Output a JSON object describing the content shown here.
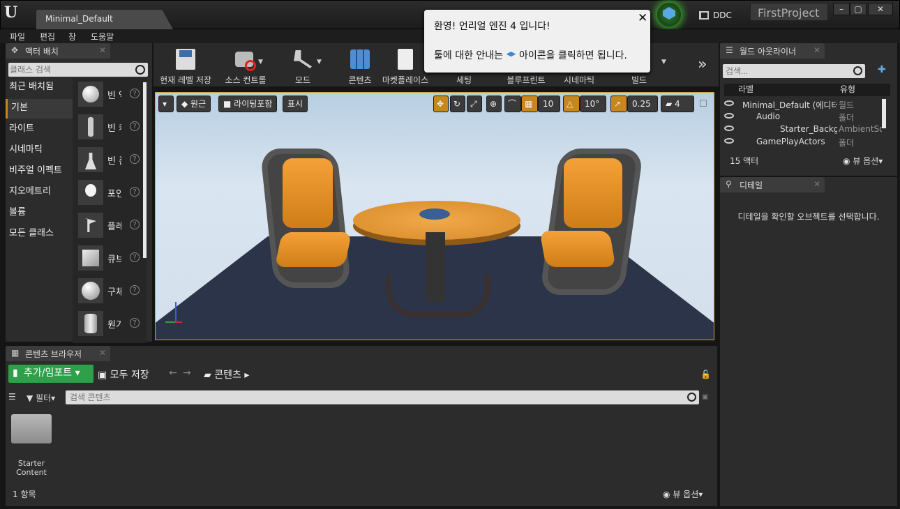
{
  "window": {
    "level_tab": "Minimal_Default",
    "project_name": "FirstProject",
    "ddc_label": "DDC"
  },
  "menu": [
    "파일",
    "편집",
    "창",
    "도움말"
  ],
  "toast": {
    "line1": "환영! 언리얼 엔진 4 입니다!",
    "line2_before": "툴에 대한 안내는 ",
    "line2_after": " 아이콘을 클릭하면 됩니다."
  },
  "place_mode": {
    "tab_label": "액터 배치",
    "search_placeholder": "클래스 검색",
    "categories": [
      "최근 배치됨",
      "기본",
      "라이트",
      "시네마틱",
      "비주얼 이펙트",
      "지오메트리",
      "볼륨",
      "모든 클래스"
    ],
    "selected_category": "기본",
    "items": [
      {
        "label": "빈 액터",
        "icon": "empty-actor-icon"
      },
      {
        "label": "빈 캐릭터",
        "icon": "empty-character-icon"
      },
      {
        "label": "빈 폰",
        "icon": "empty-pawn-icon"
      },
      {
        "label": "포인트 라이트",
        "icon": "point-light-icon"
      },
      {
        "label": "플레이어 스타트",
        "icon": "player-start-icon"
      },
      {
        "label": "큐브",
        "icon": "cube-icon"
      },
      {
        "label": "구체",
        "icon": "sphere-icon"
      },
      {
        "label": "원기둥",
        "icon": "cylinder-icon"
      }
    ]
  },
  "toolbar": [
    {
      "label": "현재 레벨 저장",
      "icon": "save-icon"
    },
    {
      "label": "소스 컨트롤",
      "icon": "source-control-icon"
    },
    {
      "label": "모드",
      "icon": "modes-icon"
    },
    {
      "label": "콘텐츠",
      "icon": "content-icon"
    },
    {
      "label": "마켓플레이스",
      "icon": "marketplace-icon"
    },
    {
      "label": "세팅",
      "icon": "settings-icon"
    },
    {
      "label": "블루프린트",
      "icon": "blueprint-icon"
    },
    {
      "label": "시네마틱",
      "icon": "cinematics-icon"
    },
    {
      "label": "빌드",
      "icon": "build-icon"
    }
  ],
  "viewport": {
    "perspective": "원근",
    "lighting": "라이팅포함",
    "show": "표시",
    "grid_snap": "10",
    "rotation_snap": "10°",
    "scale_snap": "0.25",
    "camera_speed": "4"
  },
  "outliner": {
    "tab_label": "월드 아웃라이너",
    "search_placeholder": "검색...",
    "col_label": "라벨",
    "col_type": "유형",
    "rows": [
      {
        "name": "Minimal_Default (에디터)",
        "type": "월드",
        "indent": 1
      },
      {
        "name": "Audio",
        "type": "폴더",
        "indent": 2
      },
      {
        "name": "Starter_Background",
        "type": "AmbientSound",
        "indent": 3
      },
      {
        "name": "GamePlayActors",
        "type": "폴더",
        "indent": 2
      }
    ],
    "actor_count": "15 액터",
    "view_options": "뷰 옵션"
  },
  "details": {
    "tab_label": "디테일",
    "empty_message": "디테일을 확인할 오브젝트를 선택합니다."
  },
  "content_browser": {
    "tab_label": "콘텐츠 브라우저",
    "add_import": "추가/임포트",
    "save_all": "모두 저장",
    "path": "콘텐츠",
    "filter": "필터",
    "search_placeholder": "검색 콘텐츠",
    "items": [
      {
        "name_line1": "Starter",
        "name_line2": "Content"
      }
    ],
    "item_count": "1 항목",
    "view_options": "뷰 옵션"
  },
  "colors": {
    "accent": "#c8861e",
    "add_button": "#2ea04a",
    "viewport_border": "#c7a33e"
  }
}
